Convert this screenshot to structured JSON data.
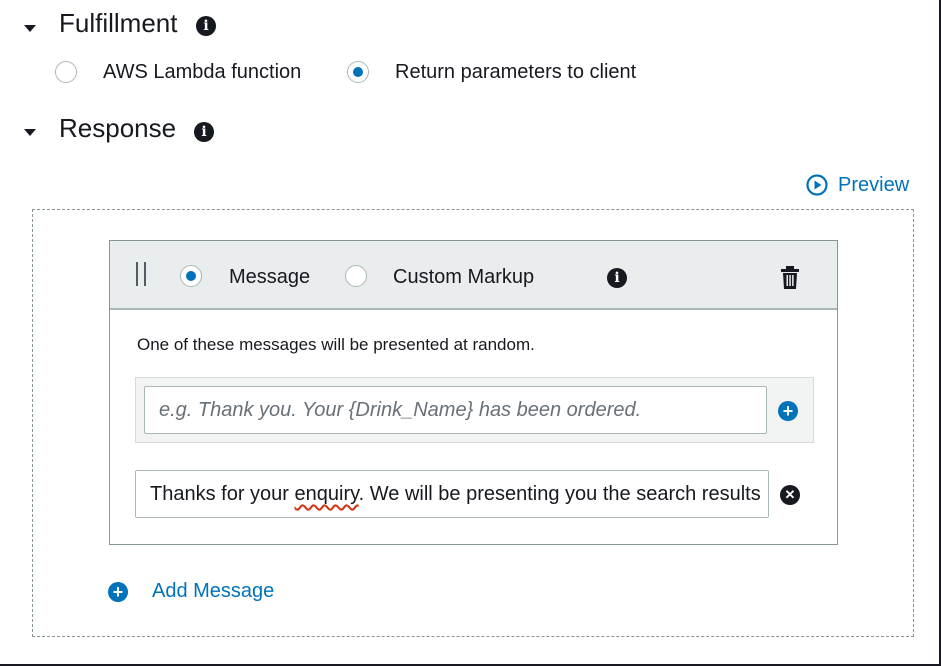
{
  "fulfillment": {
    "title": "Fulfillment",
    "options": [
      {
        "label": "AWS Lambda function",
        "selected": false
      },
      {
        "label": "Return parameters to client",
        "selected": true
      }
    ]
  },
  "response": {
    "title": "Response",
    "preview_label": "Preview",
    "card": {
      "type_options": [
        {
          "label": "Message",
          "selected": true
        },
        {
          "label": "Custom Markup",
          "selected": false
        }
      ],
      "help_text": "One of these messages will be presented at random.",
      "new_message_placeholder": "e.g. Thank you. Your {Drink_Name} has been ordered.",
      "message_before": "Thanks for your ",
      "message_misspelled": "enquiry",
      "message_after": ". We will be presenting you the search results"
    },
    "add_message_label": "Add Message"
  },
  "colors": {
    "accent": "#0073bb",
    "text": "#16191f",
    "header_bg": "#eaeded"
  },
  "icons": [
    "caret-down-icon",
    "info-icon",
    "play-circle-icon",
    "drag-handle-icon",
    "trash-icon",
    "add-circle-icon",
    "remove-circle-icon"
  ]
}
